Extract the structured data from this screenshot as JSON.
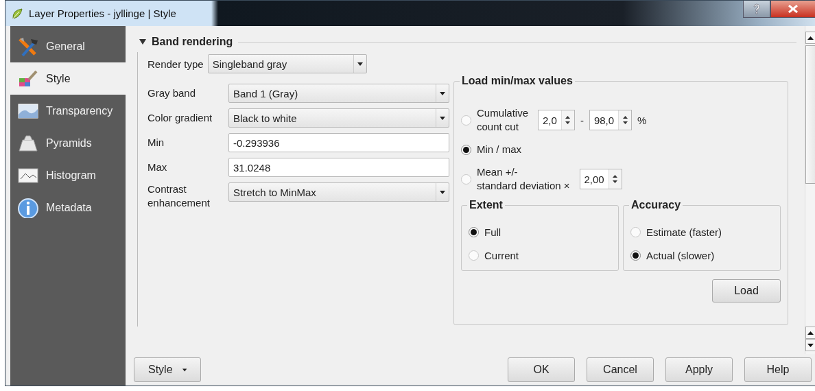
{
  "window": {
    "title": "Layer Properties - jyllinge | Style"
  },
  "sidebar": {
    "items": [
      {
        "label": "General",
        "selected": false
      },
      {
        "label": "Style",
        "selected": true
      },
      {
        "label": "Transparency",
        "selected": false
      },
      {
        "label": "Pyramids",
        "selected": false
      },
      {
        "label": "Histogram",
        "selected": false
      },
      {
        "label": "Metadata",
        "selected": false
      }
    ]
  },
  "band_rendering": {
    "title": "Band rendering",
    "expanded": true,
    "render_type": {
      "label": "Render type",
      "value": "Singleband gray"
    },
    "fields": [
      {
        "kind": "combo",
        "label": "Gray band",
        "value": "Band 1 (Gray)"
      },
      {
        "kind": "combo",
        "label": "Color gradient",
        "value": "Black to white"
      },
      {
        "kind": "text",
        "label": "Min",
        "value": "-0.293936"
      },
      {
        "kind": "text",
        "label": "Max",
        "value": "31.0248"
      },
      {
        "kind": "combo",
        "label": "Contrast\nenhancement",
        "value": "Stretch to MinMax"
      }
    ],
    "load_minmax": {
      "title": "Load min/max values",
      "options": [
        {
          "kind": "range",
          "label": "Cumulative\ncount cut",
          "selected": false,
          "from": "2,0",
          "separator": "-",
          "to": "98,0",
          "unit": "%"
        },
        {
          "kind": "plain",
          "label": "Min / max",
          "selected": true
        },
        {
          "kind": "single",
          "label": "Mean +/-\nstandard deviation ×",
          "selected": false,
          "value": "2,00"
        }
      ],
      "groups": [
        {
          "title": "Extent",
          "options": [
            {
              "label": "Full",
              "selected": true
            },
            {
              "label": "Current",
              "selected": false
            }
          ]
        },
        {
          "title": "Accuracy",
          "options": [
            {
              "label": "Estimate (faster)",
              "selected": false
            },
            {
              "label": "Actual (slower)",
              "selected": true
            }
          ]
        }
      ],
      "load_button": "Load"
    }
  },
  "footer": {
    "style_button": "Style",
    "buttons": [
      "OK",
      "Cancel",
      "Apply",
      "Help"
    ]
  }
}
